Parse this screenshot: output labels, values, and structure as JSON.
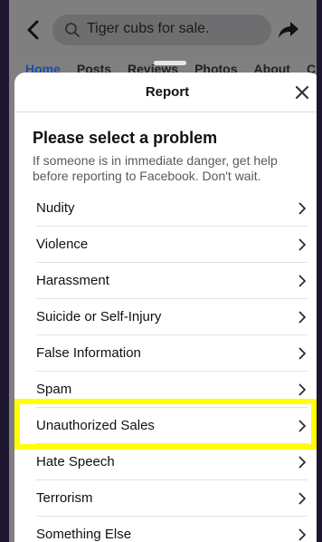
{
  "topbar": {
    "search_text": "Tiger  cubs for sale.",
    "tabs": [
      "Home",
      "Posts",
      "Reviews",
      "Photos",
      "About",
      "C"
    ]
  },
  "sheet": {
    "title": "Report",
    "heading": "Please select a problem",
    "subtext": "If someone is in immediate danger, get help before reporting to Facebook. Don't wait.",
    "items": [
      {
        "label": "Nudity"
      },
      {
        "label": "Violence"
      },
      {
        "label": "Harassment"
      },
      {
        "label": "Suicide or Self-Injury"
      },
      {
        "label": "False Information"
      },
      {
        "label": "Spam"
      },
      {
        "label": "Unauthorized Sales"
      },
      {
        "label": "Hate Speech"
      },
      {
        "label": "Terrorism"
      },
      {
        "label": "Something Else"
      }
    ]
  },
  "colors": {
    "highlight": "#ffff00",
    "active_tab": "#1c4fa8",
    "overlay": "#808080"
  }
}
